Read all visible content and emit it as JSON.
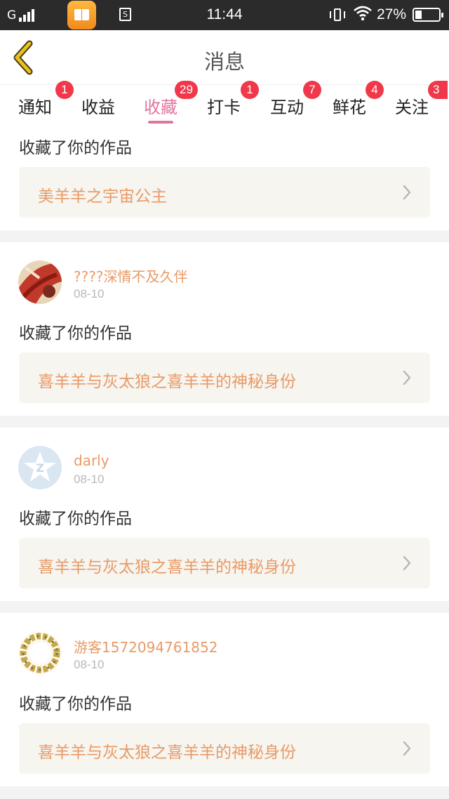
{
  "status_bar": {
    "carrier": "G",
    "time": "11:44",
    "battery_percent": "27%",
    "battery_level": 0.27,
    "icons": [
      "signal-icon",
      "reading-app-icon",
      "s-app-icon",
      "vibrate-icon",
      "wifi-icon",
      "battery-icon"
    ]
  },
  "header": {
    "title": "消息",
    "back_icon": "chevron-left-icon",
    "accent": "#e8c21e"
  },
  "tabs": [
    {
      "label": "通知",
      "badge": "1",
      "active": false
    },
    {
      "label": "收益",
      "badge": "",
      "active": false
    },
    {
      "label": "收藏",
      "badge": "29",
      "active": true
    },
    {
      "label": "打卡",
      "badge": "1",
      "active": false
    },
    {
      "label": "互动",
      "badge": "7",
      "active": false
    },
    {
      "label": "鲜花",
      "badge": "4",
      "active": false
    },
    {
      "label": "关注",
      "badge": "3",
      "active": false
    }
  ],
  "colors": {
    "active_tab": "#e5739f",
    "badge": "#f0384a",
    "username": "#e99a67",
    "work_title": "#e99a67"
  },
  "notifications": [
    {
      "user": "",
      "date": "",
      "action": "收藏了你的作品",
      "work_title": "美羊羊之宇宙公主"
    },
    {
      "user": "????深情不及久伴",
      "date": "08-10",
      "action": "收藏了你的作品",
      "work_title": "喜羊羊与灰太狼之喜羊羊的神秘身份"
    },
    {
      "user": "darly",
      "date": "08-10",
      "action": "收藏了你的作品",
      "work_title": "喜羊羊与灰太狼之喜羊羊的神秘身份"
    },
    {
      "user": "游客1572094761852",
      "date": "08-10",
      "action": "收藏了你的作品",
      "work_title": "喜羊羊与灰太狼之喜羊羊的神秘身份"
    }
  ]
}
